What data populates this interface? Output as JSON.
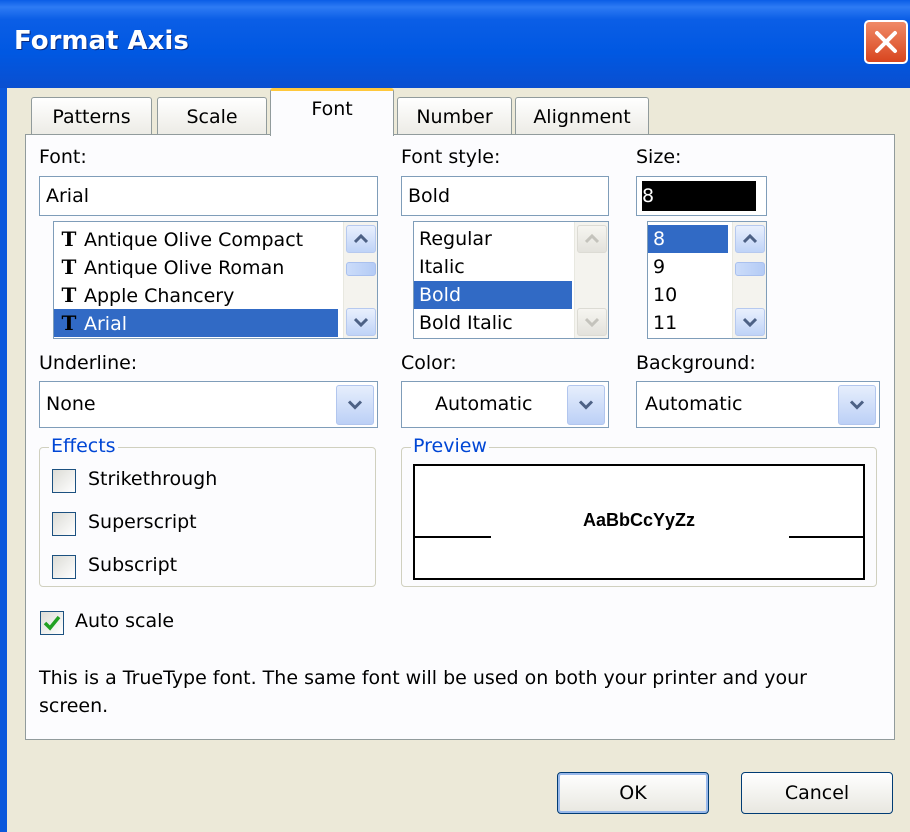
{
  "window": {
    "title": "Format Axis"
  },
  "tabs": [
    {
      "label": "Patterns"
    },
    {
      "label": "Scale"
    },
    {
      "label": "Font"
    },
    {
      "label": "Number"
    },
    {
      "label": "Alignment"
    }
  ],
  "font": {
    "label": "Font:",
    "value": "Arial",
    "list": [
      "Antique Olive Compact",
      "Antique Olive Roman",
      "Apple Chancery",
      "Arial"
    ],
    "selected": "Arial"
  },
  "font_style": {
    "label": "Font style:",
    "value": "Bold",
    "list": [
      "Regular",
      "Italic",
      "Bold",
      "Bold Italic"
    ],
    "selected": "Bold"
  },
  "size": {
    "label": "Size:",
    "value": "8",
    "list": [
      "8",
      "9",
      "10",
      "11"
    ],
    "selected": "8"
  },
  "underline": {
    "label": "Underline:",
    "value": "None"
  },
  "color": {
    "label": "Color:",
    "value": "Automatic"
  },
  "background": {
    "label": "Background:",
    "value": "Automatic"
  },
  "effects": {
    "label": "Effects",
    "strikethrough": {
      "label": "Strikethrough",
      "checked": false
    },
    "superscript": {
      "label": "Superscript",
      "checked": false
    },
    "subscript": {
      "label": "Subscript",
      "checked": false
    }
  },
  "preview": {
    "label": "Preview",
    "sample": "AaBbCcYyZz"
  },
  "auto_scale": {
    "label": "Auto scale",
    "checked": true
  },
  "info_text": "This is a TrueType font.  The same font will be used on both your printer and your screen.",
  "buttons": {
    "ok": "OK",
    "cancel": "Cancel"
  },
  "colors": {
    "titlebar": "#0058e2",
    "selection": "#316ac5",
    "group_label": "#0046d5",
    "tab_highlight": "#ffc83c",
    "close_button": "#d8451f"
  }
}
